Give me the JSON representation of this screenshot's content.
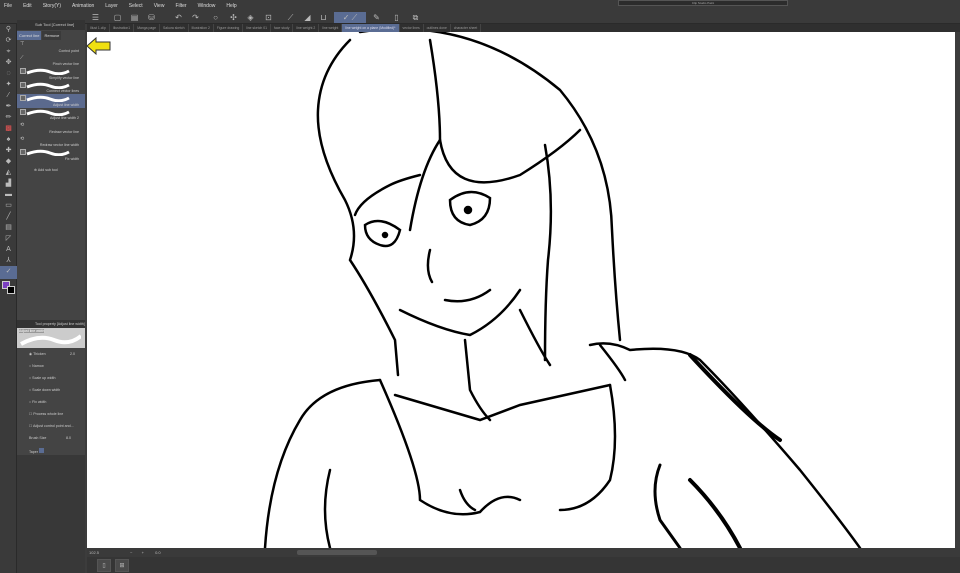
{
  "window": {
    "title": "Clip Studio Paint"
  },
  "menu": [
    "File",
    "Edit",
    "Story(Y)",
    "Animation",
    "Layer",
    "Select",
    "View",
    "Filter",
    "Window",
    "Help"
  ],
  "doc_tabs": [
    "Illust 1.clip",
    "Illustration1",
    "Manga page",
    "Sakura sketch",
    "Illustration 2",
    "Figure drawing",
    "line sketch 01",
    "face study",
    "line weight 2",
    "line weight",
    "line weight on a plane (Modified)*",
    "vector lines",
    "outlines done",
    "character sheet"
  ],
  "active_tab_index": 10,
  "subtool_panel": {
    "header": "Sub Tool [Correct line]",
    "tabs": [
      "Correct line",
      "Remove"
    ],
    "items": [
      "Control point",
      "Pinch vector line",
      "Simplify vector line",
      "Connect vector lines",
      "Adjust line width",
      "Adjust line width 2",
      "Redraw vector line",
      "Redraw vector line width",
      "Fix width"
    ],
    "active_index": 4,
    "add_label": "Add sub tool"
  },
  "tool_property": {
    "header": "Tool property [Adjust line width]",
    "preset": "Adjust line width",
    "options": [
      "Thicken",
      "Narrow",
      "Scale up width",
      "Scale down width",
      "Fix width"
    ],
    "selected_option": 0,
    "thicken_value": "2.0",
    "process_whole_line": "Process whole line",
    "adjust_layers": "Adjust control point and... ",
    "brush_size_label": "Brush Size",
    "brush_size": "8.0",
    "taper_label": "Taper"
  },
  "status": {
    "zoom": "102.5",
    "angle": "0.0"
  },
  "colors": {
    "accent": "#5a6c93",
    "main_color": "#7a3fc0",
    "sub_color": "#000000",
    "arrow": "#f0e010"
  }
}
